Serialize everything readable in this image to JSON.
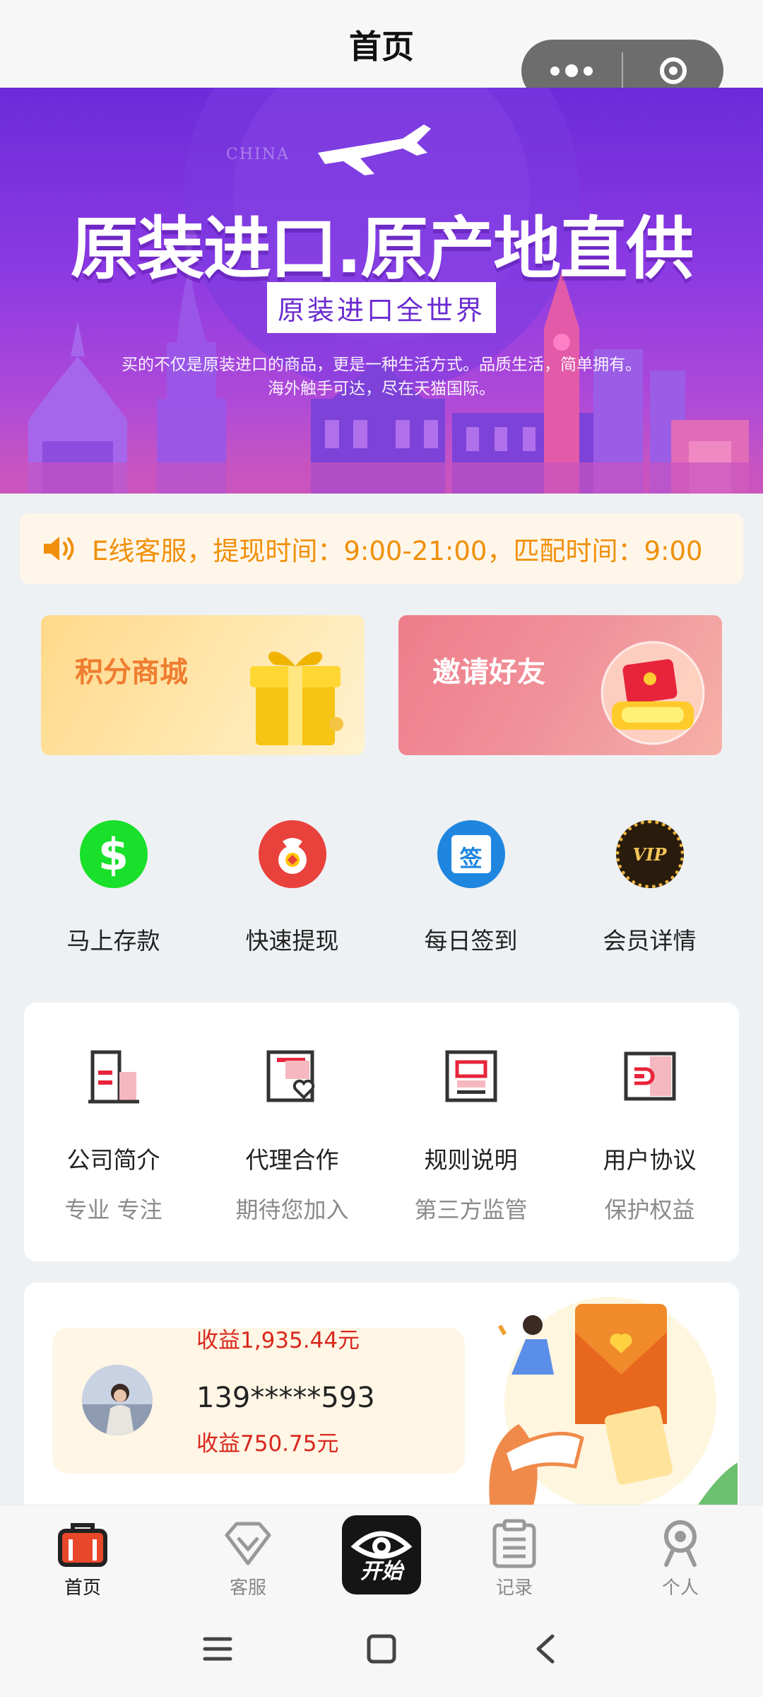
{
  "header": {
    "title": "首页"
  },
  "banner": {
    "china_text": "CHINA",
    "headline": "原装进口.原产地直供",
    "tag": "原装进口全世界",
    "desc_line1": "买的不仅是原装进口的商品，更是一种生活方式。品质生活，简单拥有。",
    "desc_line2": "海外触手可达，尽在天猫国际。"
  },
  "notice": {
    "text": "E线客服，提现时间：9:00-21:00，匹配时间：9:00"
  },
  "promos": {
    "points": "积分商城",
    "invite": "邀请好友"
  },
  "quick_actions": [
    {
      "label": "马上存款",
      "icon": "dollar-icon"
    },
    {
      "label": "快速提现",
      "icon": "money-bag-icon"
    },
    {
      "label": "每日签到",
      "icon": "sign-in-calendar-icon",
      "glyph": "签"
    },
    {
      "label": "会员详情",
      "icon": "vip-badge-icon",
      "glyph": "VIP"
    }
  ],
  "info_items": [
    {
      "title": "公司简介",
      "subtitle": "专业 专注",
      "icon": "company-building-icon"
    },
    {
      "title": "代理合作",
      "subtitle": "期待您加入",
      "icon": "agent-doc-heart-icon"
    },
    {
      "title": "规则说明",
      "subtitle": "第三方监管",
      "icon": "rules-doc-icon"
    },
    {
      "title": "用户协议",
      "subtitle": "保护权益",
      "icon": "agreement-doc-icon"
    }
  ],
  "earnings": {
    "prev_income": "收益1,935.44元",
    "phone": "139*****593",
    "income": "收益750.75元"
  },
  "tabbar": {
    "home": "首页",
    "service": "客服",
    "start": "开始",
    "records": "记录",
    "profile": "个人"
  },
  "colors": {
    "accent_orange": "#f0900a",
    "income_red": "#d9271c",
    "banner_purple": "#7b32dd"
  }
}
